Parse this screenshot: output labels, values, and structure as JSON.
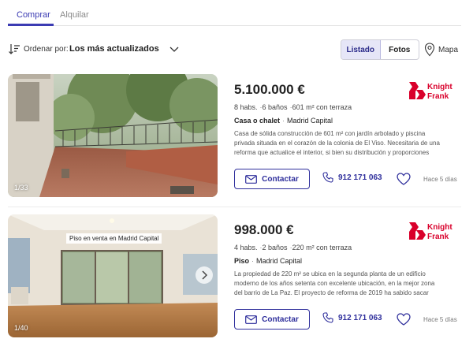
{
  "tabs": [
    {
      "label": "Comprar",
      "active": true
    },
    {
      "label": "Alquilar",
      "active": false
    }
  ],
  "sort": {
    "label": "Ordenar por:",
    "value": "Los más actualizados",
    "view_options": [
      "Listado",
      "Fotos"
    ],
    "active_view": "Listado",
    "map_label": "Mapa"
  },
  "colors": {
    "accent": "#2f2f9c",
    "brand_logo": "#d9002b"
  },
  "listings": [
    {
      "price": "5.100.000 €",
      "rooms": "8 habs.",
      "baths": "6 baños",
      "area": "601 m²",
      "extra": "con terraza",
      "type": "Casa o chalet",
      "location": "Madrid Capital",
      "description": "Casa de sólida construcción de 601 m² con jardín arbolado y piscina privada situada en el corazón de la colonia de El Viso. Necesitaria de una reforma que actualice el interior, si bien su distribución y proporciones permiten…",
      "photo_counter": "1/33",
      "agency_logo": [
        "Knight",
        "Frank"
      ],
      "contact_label": "Contactar",
      "phone": "912 171 063",
      "updated": "Hace 5 días"
    },
    {
      "price": "998.000 €",
      "rooms": "4 habs.",
      "baths": "2 baños",
      "area": "220 m²",
      "extra": "con terraza",
      "type": "Piso",
      "location": "Madrid Capital",
      "description": "La propiedad de 220 m² se ubica en la segunda planta de un edificio moderno de los años setenta con excelente ubicación, en la mejor zona del barrio de La Paz. El proyecto de reforma de 2019 ha sabido sacar provec…",
      "photo_counter": "1/40",
      "photo_tag": "Piso en venta en  Madrid Capital",
      "agency_logo": [
        "Knight",
        "Frank"
      ],
      "contact_label": "Contactar",
      "phone": "912 171 063",
      "updated": "Hace 5 días"
    }
  ]
}
